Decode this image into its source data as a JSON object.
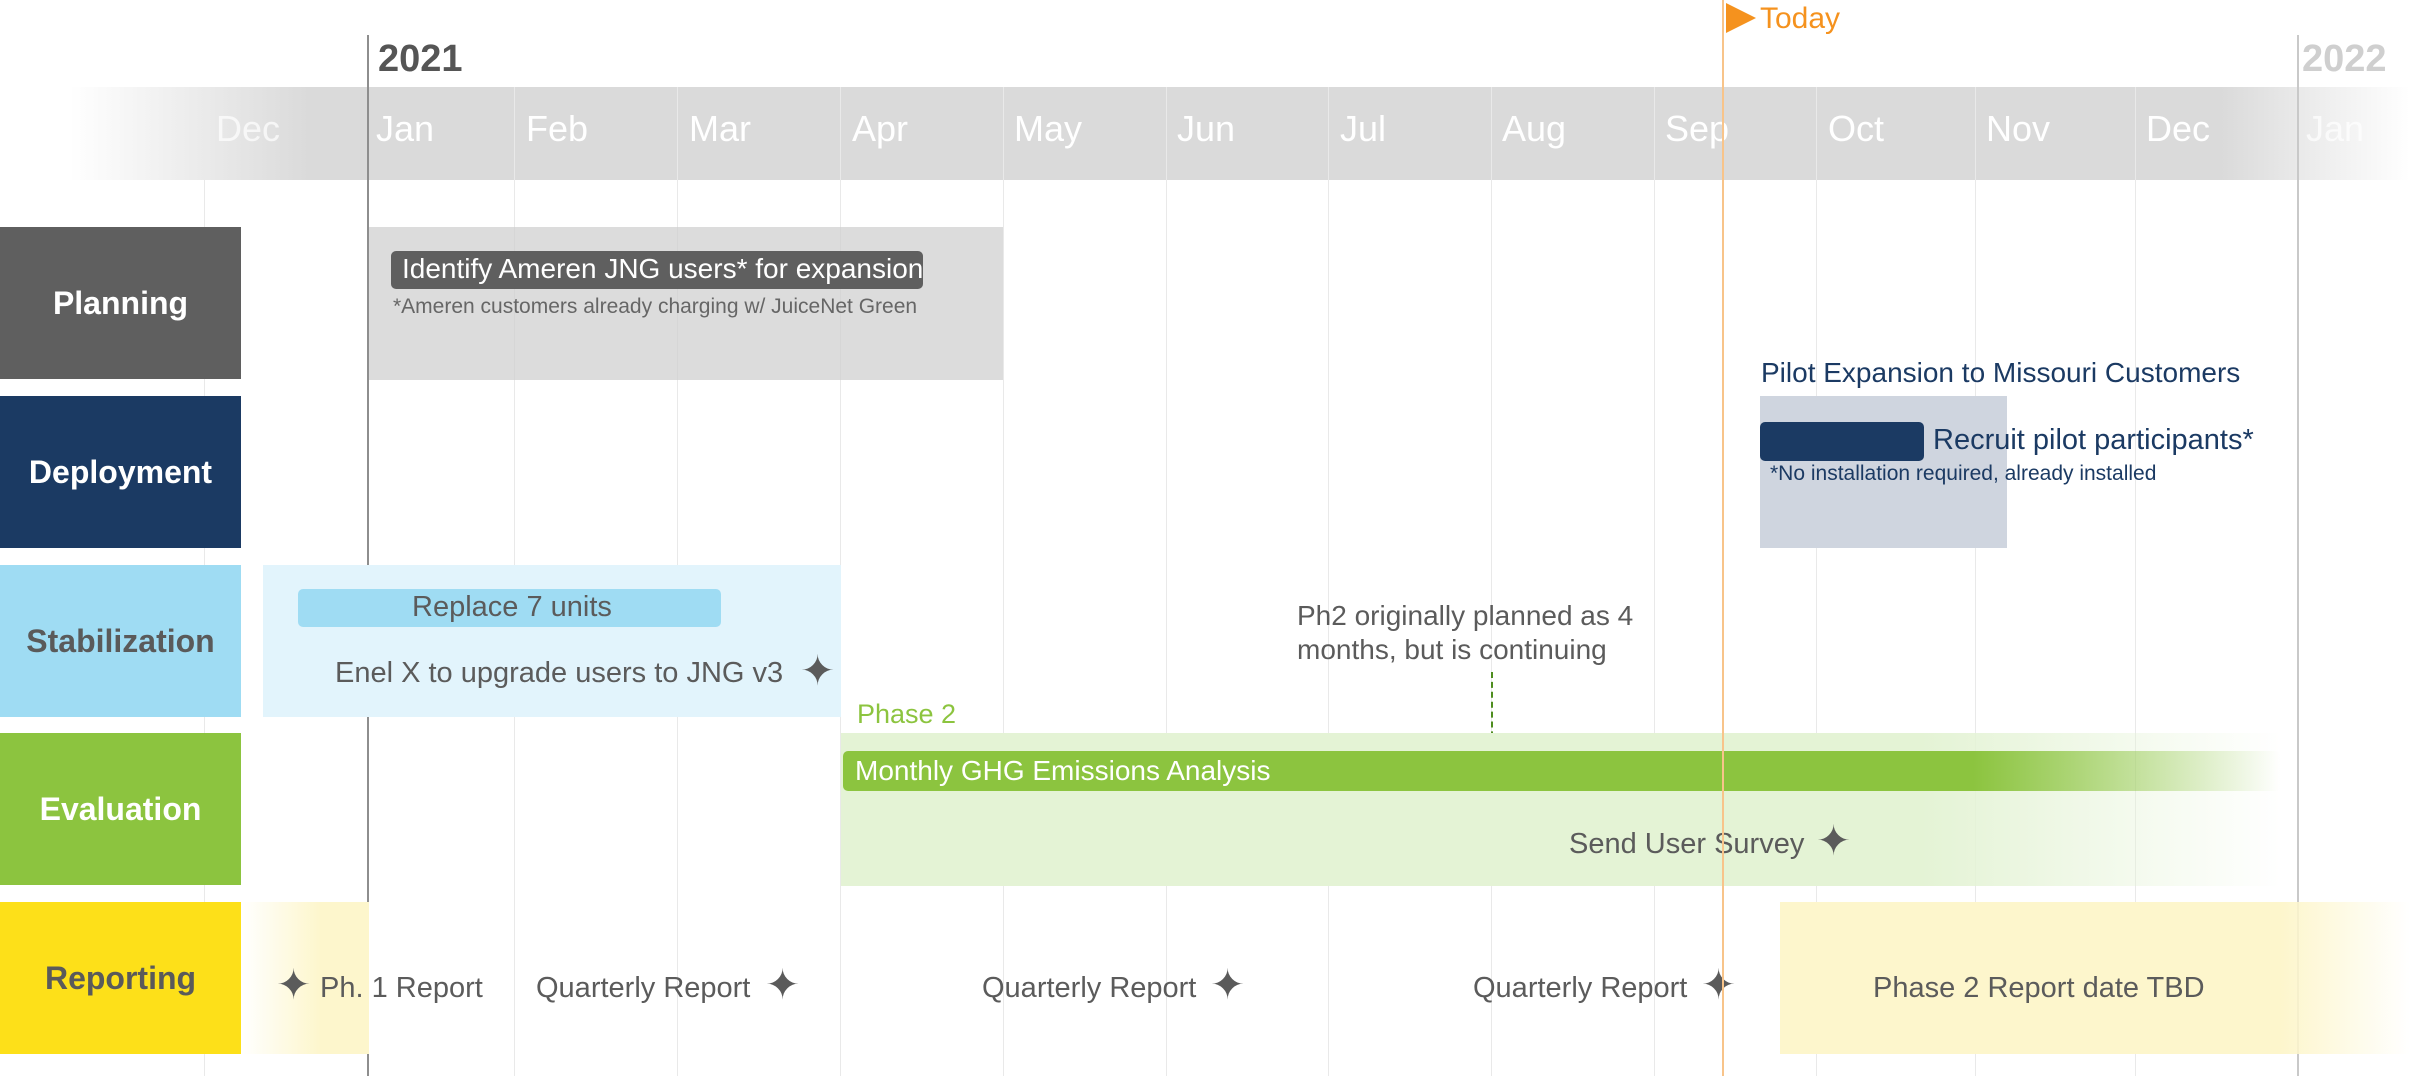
{
  "timeline": {
    "year_start": "2021",
    "year_end": "2022",
    "months": [
      "Dec",
      "Jan",
      "Feb",
      "Mar",
      "Apr",
      "May",
      "Jun",
      "Jul",
      "Aug",
      "Sep",
      "Oct",
      "Nov",
      "Dec",
      "Jan"
    ],
    "today_label": "Today"
  },
  "rows": {
    "planning": "Planning",
    "deployment": "Deployment",
    "stabilization": "Stabilization",
    "evaluation": "Evaluation",
    "reporting": "Reporting"
  },
  "planning": {
    "task": "Identify Ameren JNG users* for expansion",
    "note": "*Ameren customers already charging w/ JuiceNet Green"
  },
  "deployment": {
    "title": "Pilot Expansion to Missouri Customers",
    "task": "Recruit pilot participants*",
    "note": "*No installation required, already installed"
  },
  "stabilization": {
    "task": "Replace 7 units",
    "milestone": "Enel X to upgrade users to JNG v3"
  },
  "annotation": {
    "line1": "Ph2 originally planned as 4",
    "line2": "months, but is continuing"
  },
  "evaluation": {
    "phase_label": "Phase 2",
    "task": "Monthly GHG Emissions Analysis",
    "milestone": "Send User Survey"
  },
  "reporting": {
    "m1": "Ph. 1 Report",
    "m2": "Quarterly Report",
    "m3": "Quarterly Report",
    "m4": "Quarterly Report",
    "phase2": "Phase 2 Report date TBD"
  },
  "colors": {
    "planning": "#5f5f5f",
    "deployment": "#1b3a63",
    "stabilization": "#9fdcf3",
    "evaluation": "#8cc43f",
    "reporting": "#fde019",
    "today": "#f5921e"
  }
}
